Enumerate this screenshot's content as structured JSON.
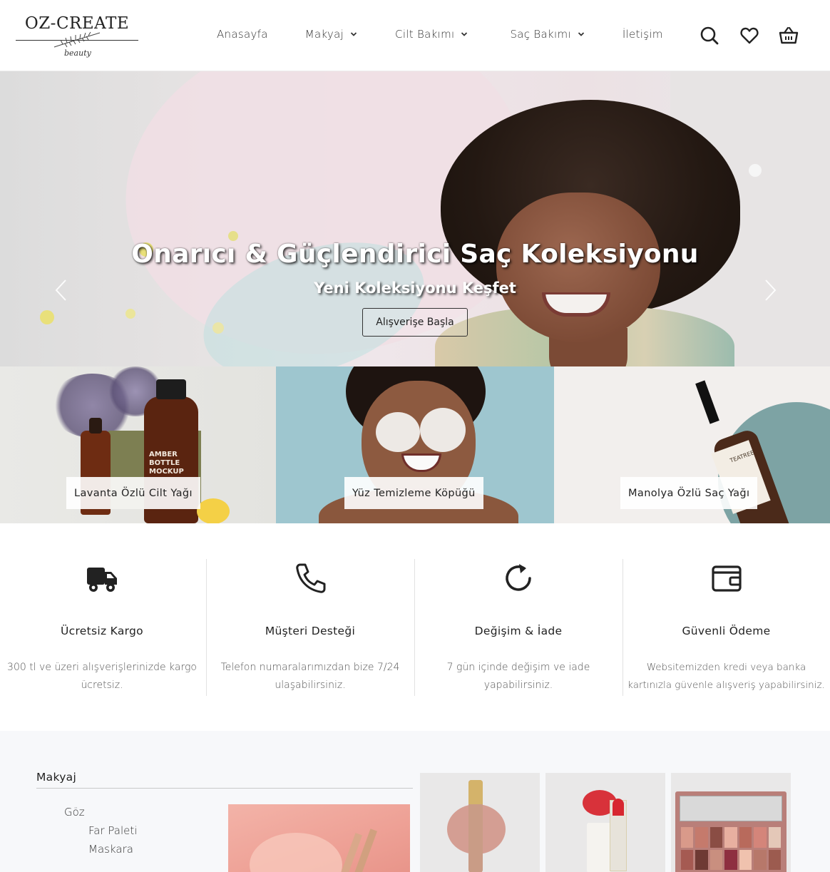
{
  "brand": {
    "logo_text": "OZ-CREATE",
    "logo_script": "beauty"
  },
  "nav": {
    "items": [
      {
        "label": "Anasayfa",
        "has_dropdown": false
      },
      {
        "label": "Makyaj",
        "has_dropdown": true
      },
      {
        "label": "Cilt Bakımı",
        "has_dropdown": true
      },
      {
        "label": "Saç Bakımı",
        "has_dropdown": true
      },
      {
        "label": "İletişim",
        "has_dropdown": false
      }
    ],
    "icons": [
      "search-icon",
      "heart-icon",
      "cart-icon"
    ]
  },
  "hero": {
    "title": "Onarıcı & Güçlendirici Saç Koleksiyonu",
    "subtitle": "Yeni Koleksiyonu Keşfet",
    "button": "Alışverişe Başla",
    "prev_icon": "chevron-left-icon",
    "next_icon": "chevron-right-icon"
  },
  "banners": [
    {
      "label": "Lavanta Özlü Cilt Yağı",
      "bottle_text": "AMBER BOTTLE MOCKUP"
    },
    {
      "label": "Yüz Temizleme Köpüğü"
    },
    {
      "label": "Manolya Özlü Saç Yağı",
      "bottle_text": "TEATREE"
    }
  ],
  "features": [
    {
      "icon": "truck-icon",
      "title": "Ücretsiz Kargo",
      "desc_line1": "300 tl ve üzeri alışverişlerinizde kargo",
      "desc_line2": "ücretsiz."
    },
    {
      "icon": "phone-icon",
      "title": "Müşteri Desteği",
      "desc_line1": "Telefon numaralarımızdan bize 7/24",
      "desc_line2": "ulaşabilirsiniz."
    },
    {
      "icon": "refresh-icon",
      "title": "Değişim & İade",
      "desc_line1": "7 gün içinde değişim ve iade",
      "desc_line2": "yapabilirsiniz."
    },
    {
      "icon": "wallet-icon",
      "title": "Güvenli Ödeme",
      "desc_line1": "Websitemizden kredi veya banka",
      "desc_line2": "kartınızla güvenle alışveriş yapabilirsiniz."
    }
  ],
  "menu": {
    "title": "Makyaj",
    "category": "Göz",
    "items": [
      "Far Paleti",
      "Maskara"
    ]
  },
  "colors": {
    "text": "#222222",
    "header_bg": "#ffffff",
    "bottom_bg": "#f7f8fa",
    "hero_pink": "#f0dfe4"
  }
}
